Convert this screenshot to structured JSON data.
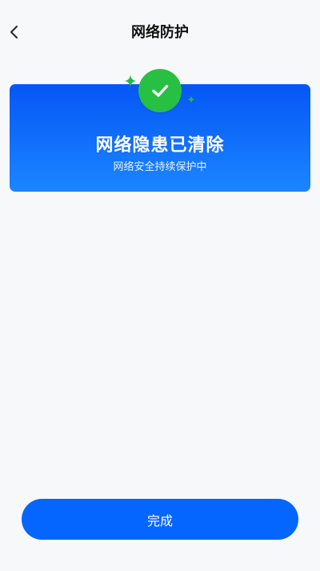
{
  "header": {
    "title": "网络防护",
    "back_icon": "chevron-left-icon"
  },
  "status_card": {
    "title": "网络隐患已清除",
    "subtitle": "网络安全持续保护中",
    "icon": "checkmark-icon",
    "colors": {
      "gradient_top": "#0556f5",
      "gradient_bottom": "#1b86ff",
      "badge": "#27c043"
    }
  },
  "footer": {
    "done_label": "完成",
    "button_color": "#0466ff"
  }
}
